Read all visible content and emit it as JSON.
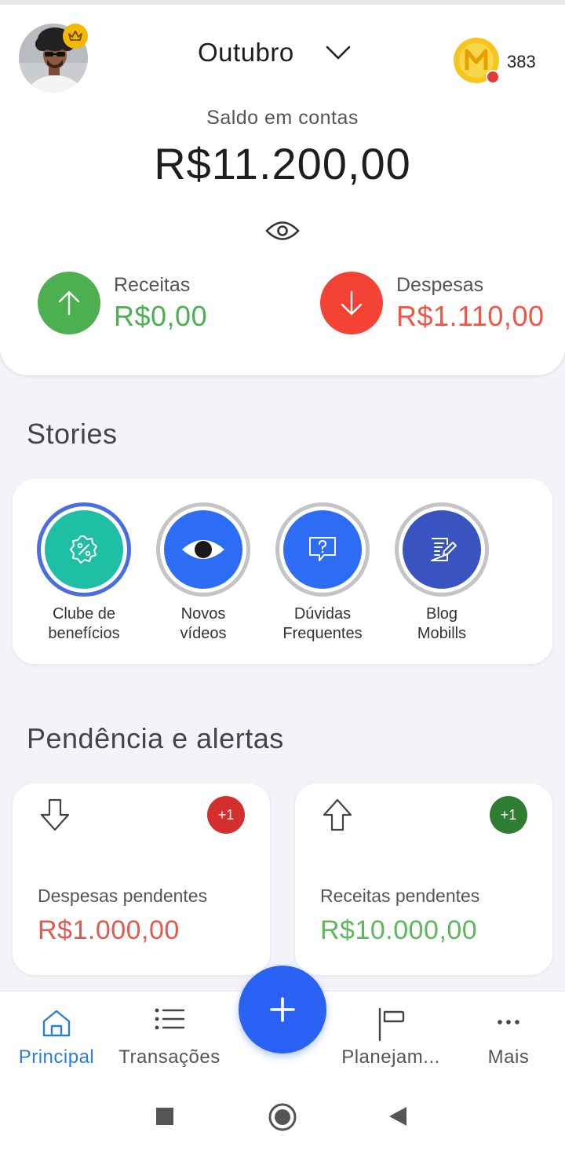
{
  "header": {
    "month": "Outubro",
    "coin_count": "383",
    "balance_label": "Saldo em contas",
    "balance_value": "R$11.200,00"
  },
  "summary": {
    "income": {
      "label": "Receitas",
      "value": "R$0,00",
      "color": "#4caf50"
    },
    "expense": {
      "label": "Despesas",
      "value": "R$1.110,00",
      "color": "#f44336"
    }
  },
  "stories": {
    "title": "Stories",
    "items": [
      {
        "line1": "Clube de",
        "line2": "benefícios",
        "icon": "percent-badge-icon",
        "color": "#1fbfa5"
      },
      {
        "line1": "Novos",
        "line2": "vídeos",
        "icon": "eye-icon",
        "color": "#2d6df6"
      },
      {
        "line1": "Dúvidas",
        "line2": "Frequentes",
        "icon": "question-bubble-icon",
        "color": "#2d6df6"
      },
      {
        "line1": "Blog",
        "line2": "Mobills",
        "icon": "blog-edit-icon",
        "color": "#3953c0"
      }
    ]
  },
  "alerts": {
    "title": "Pendência e alertas",
    "pending_expenses": {
      "label": "Despesas pendentes",
      "value": "R$1.000,00",
      "badge": "+1",
      "color": "#e05a4f",
      "badge_color": "#d32f2f"
    },
    "pending_income": {
      "label": "Receitas pendentes",
      "value": "R$10.000,00",
      "badge": "+1",
      "color": "#5cb85c",
      "badge_color": "#2e7d32"
    }
  },
  "nav": {
    "items": [
      {
        "label": "Principal",
        "icon": "home-icon",
        "active": true
      },
      {
        "label": "Transações",
        "icon": "list-icon",
        "active": false
      },
      {
        "label": "Planejam...",
        "icon": "flag-icon",
        "active": false
      },
      {
        "label": "Mais",
        "icon": "more-dots-icon",
        "active": false
      }
    ],
    "accent": "#2a7fd4",
    "fab_icon": "plus-icon"
  }
}
